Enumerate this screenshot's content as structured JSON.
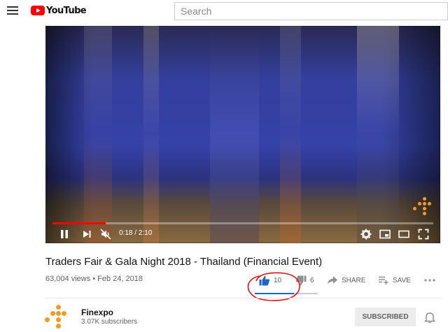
{
  "header": {
    "menu_icon": "hamburger-menu-icon",
    "logo_text": "YouTube",
    "search_placeholder": "Search"
  },
  "player": {
    "current_time": "0:18",
    "duration": "2:10",
    "time_display": "0:18 / 2:10",
    "progress_fraction": 0.14,
    "icons": [
      "pause-icon",
      "next-icon",
      "mute-icon",
      "settings-icon",
      "miniplayer-icon",
      "theater-icon",
      "fullscreen-icon"
    ]
  },
  "video": {
    "title": "Traders Fair & Gala Night 2018 - Thailand (Financial Event)",
    "views": "63,004 views",
    "date": "Feb 24, 2018",
    "meta": "63,004 views • Feb 24, 2018"
  },
  "actions": {
    "likes": "10",
    "dislikes": "6",
    "share_label": "SHARE",
    "save_label": "SAVE",
    "like_ratio": 0.62
  },
  "channel": {
    "name": "Finexpo",
    "subscribers": "3.07K subscribers",
    "subscribe_label": "SUBSCRIBED"
  },
  "colors": {
    "brand_red": "#ff0000",
    "like_blue": "#1a66d2",
    "annotation_red": "#e01010",
    "finexpo_orange": "#f39a2b"
  }
}
